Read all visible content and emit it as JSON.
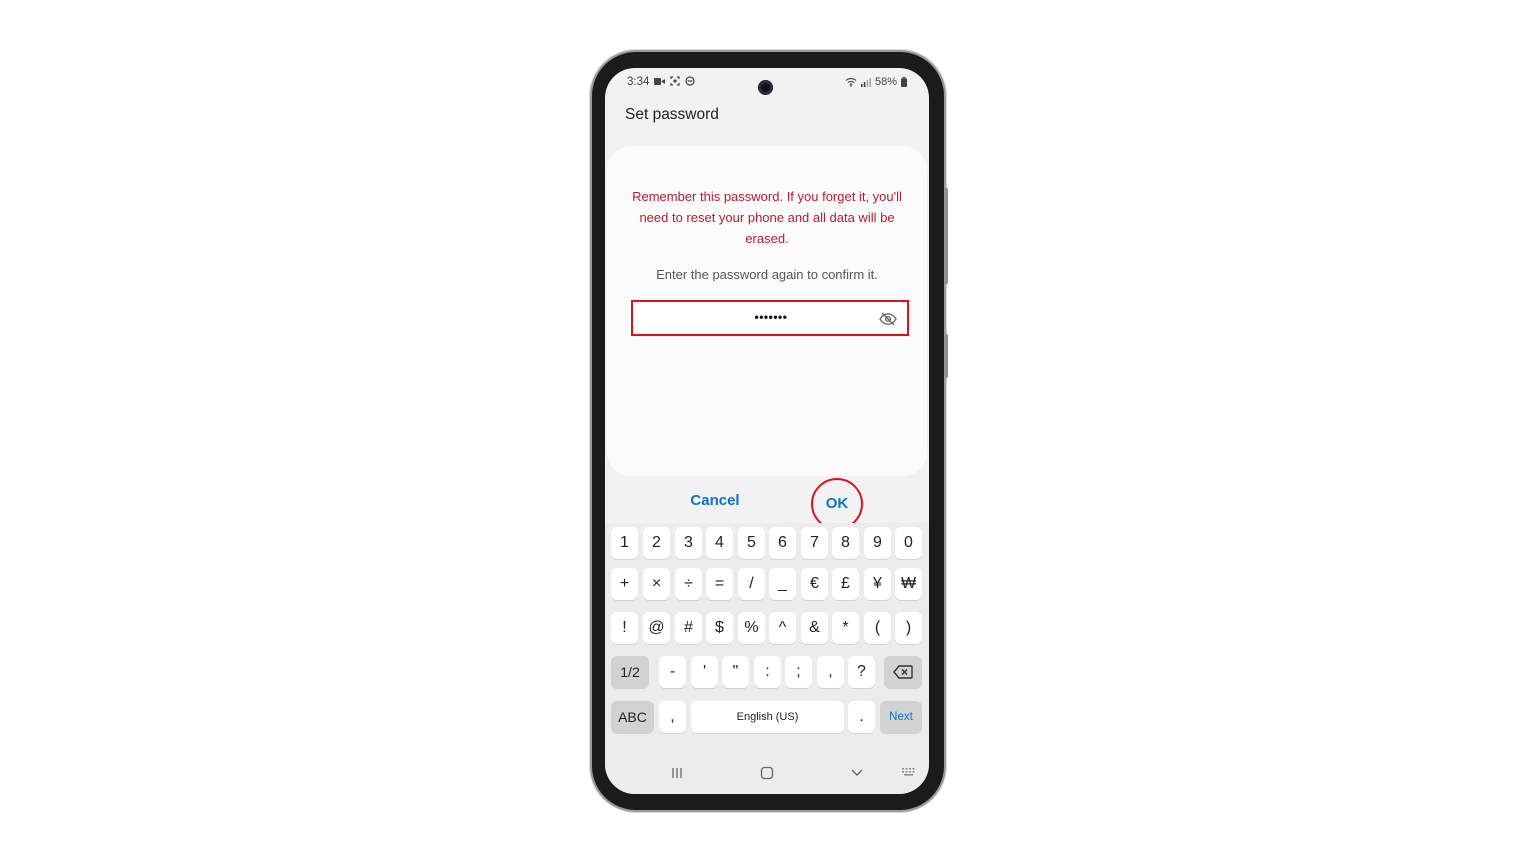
{
  "status_bar": {
    "time": "3:34",
    "battery": "58%"
  },
  "page": {
    "title": "Set password"
  },
  "dialog": {
    "warning": "Remember this password. If you forget it, you'll need to reset your phone and all data will be erased.",
    "instruction": "Enter the password again to confirm it.",
    "password_masked": "•••••••",
    "cancel_label": "Cancel",
    "ok_label": "OK"
  },
  "keyboard": {
    "row1": [
      "1",
      "2",
      "3",
      "4",
      "5",
      "6",
      "7",
      "8",
      "9",
      "0"
    ],
    "row2": [
      "+",
      "×",
      "÷",
      "=",
      "/",
      "_",
      "€",
      "£",
      "¥",
      "₩"
    ],
    "row3": [
      "!",
      "@",
      "#",
      "$",
      "%",
      "^",
      "&",
      "*",
      "(",
      ")"
    ],
    "row4": {
      "page_toggle": "1/2",
      "keys": [
        "-",
        "'",
        "\"",
        ":",
        ";",
        ",",
        "?"
      ]
    },
    "row5": {
      "abc": "ABC",
      "comma": ",",
      "space": "English (US)",
      "period": ".",
      "next": "Next"
    }
  },
  "colors": {
    "accent": "#0b73c8",
    "warning": "#b51c2c",
    "highlight": "#e0101a"
  },
  "icons": {
    "status_left": [
      "video-record-icon",
      "screenshot-icon",
      "do-not-disturb-icon"
    ],
    "status_right": [
      "wifi-icon",
      "signal-icon",
      "battery-icon"
    ],
    "field": "eye-hidden-icon",
    "backspace": "backspace-icon",
    "nav": [
      "recents-icon",
      "home-icon",
      "back-icon",
      "keyboard-icon"
    ]
  }
}
